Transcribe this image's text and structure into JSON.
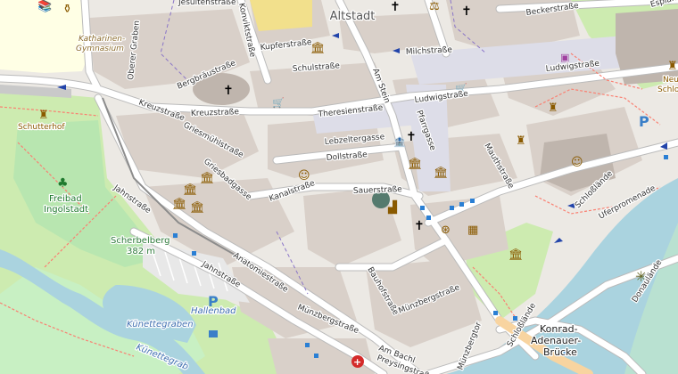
{
  "map": {
    "district": "Altstadt",
    "streets": [
      {
        "id": "jesuitenstrasse",
        "text": "Jesuitenstraße"
      },
      {
        "id": "konviktstrasse",
        "text": "Konviktstraße"
      },
      {
        "id": "kupferstrasse",
        "text": "Kupferstraße"
      },
      {
        "id": "schulstrasse",
        "text": "Schulstraße"
      },
      {
        "id": "milchstrasse",
        "text": "Milchstraße"
      },
      {
        "id": "beckerstrasse",
        "text": "Beckerstraße"
      },
      {
        "id": "esplanade",
        "text": "Esplana"
      },
      {
        "id": "ludwigstrasse-east",
        "text": "Ludwigstraße"
      },
      {
        "id": "ludwigstrasse-west",
        "text": "Ludwigstraße"
      },
      {
        "id": "am-stein",
        "text": "Am Stein"
      },
      {
        "id": "oberer-graben",
        "text": "Oberer Graben"
      },
      {
        "id": "bergbraeustrasse",
        "text": "Bergbräustraße"
      },
      {
        "id": "kreuzstrasse-1",
        "text": "Kreuzstraße"
      },
      {
        "id": "kreuzstrasse-2",
        "text": "Kreuzstraße"
      },
      {
        "id": "theresienstrasse",
        "text": "Theresienstraße"
      },
      {
        "id": "pfarrgasse",
        "text": "Pfarrgasse"
      },
      {
        "id": "lebzeltergasse",
        "text": "Lebzeltergasse"
      },
      {
        "id": "griesmuehlstrasse",
        "text": "Griesmühlstraße"
      },
      {
        "id": "dollstrasse",
        "text": "Dollstraße"
      },
      {
        "id": "griesbadgasse",
        "text": "Griesbadgasse"
      },
      {
        "id": "mauthstrasse",
        "text": "Mauthstraße"
      },
      {
        "id": "jahnstrasse-1",
        "text": "Jahnstraße"
      },
      {
        "id": "kanalstrasse",
        "text": "Kanalstraße"
      },
      {
        "id": "sauerstrasse",
        "text": "Sauerstraße"
      },
      {
        "id": "anatomiestrasse",
        "text": "Anatomiestraße"
      },
      {
        "id": "jahnstrasse-2",
        "text": "Jahnstraße"
      },
      {
        "id": "bauhofstrasse",
        "text": "Bauhofstraße"
      },
      {
        "id": "munzbergstrasse-1",
        "text": "Münzbergstraße"
      },
      {
        "id": "munzbergstrasse-2",
        "text": "Münzbergstraße"
      },
      {
        "id": "munzbergtor",
        "text": "Münzbergtor"
      },
      {
        "id": "schlosslaende-1",
        "text": "Schloßlände"
      },
      {
        "id": "schlosslaende-2",
        "text": "Schloßlände"
      },
      {
        "id": "uferpromenade",
        "text": "Uferpromenade"
      },
      {
        "id": "donaulaende",
        "text": "Donaulände"
      },
      {
        "id": "am-bachl",
        "text": "Am Bachl"
      },
      {
        "id": "preysingstrasse",
        "text": "Preysingstraß"
      }
    ],
    "places": {
      "katharinen_gymnasium": "Katharinen-\nGymnasium",
      "katharinen_line1": "Katharinen-",
      "katharinen_line2": "Gymnasium",
      "schutterhof": "Schutterhof",
      "freibad_line1": "Freibad",
      "freibad_line2": "Ingolstadt",
      "scherbelberg": "Scherbelberg",
      "scherbelberg_ele": "382 m",
      "hallenbad": "Hallenbad",
      "kunettegraben": "Künettegraben",
      "kunettegraben2": "Künettegrab",
      "konrad_line1": "Konrad-",
      "konrad_line2": "Adenauer-",
      "konrad_line3": "Brücke",
      "neues_schloss_1": "Neue",
      "neues_schloss_2": "Schlo"
    },
    "colors": {
      "background": "#ece9e4",
      "building": "#d9d0c9",
      "park": "#c8f0c3",
      "water": "#aad3df",
      "road": "#ffffff",
      "pedestrian": "#dddde8",
      "footway": "#fa8072",
      "school": "#ffffe5"
    }
  }
}
